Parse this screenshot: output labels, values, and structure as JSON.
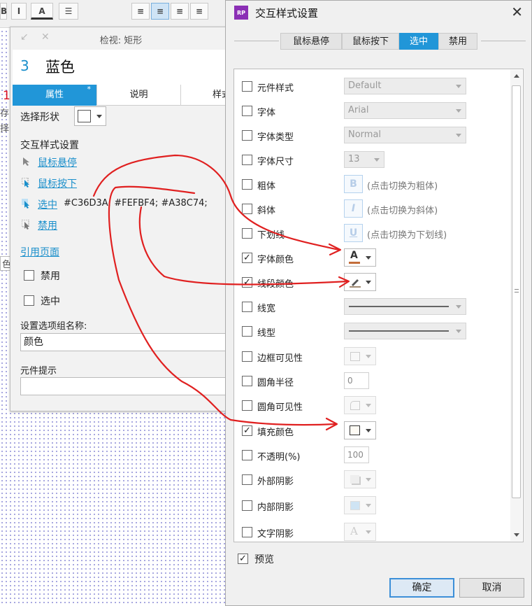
{
  "left_panel": {
    "fragments": [
      "1",
      "存",
      "择",
      "色"
    ]
  },
  "inspector": {
    "title": "检视: 矩形",
    "shape_number": "3",
    "shape_name": "蓝色",
    "tabs": [
      {
        "label": "属性",
        "active": true,
        "marker": "*"
      },
      {
        "label": "说明"
      },
      {
        "label": "样式"
      }
    ],
    "select_shape_label": "选择形状",
    "interaction_heading": "交互样式设置",
    "hover_link": "鼠标悬停",
    "mousedown_link": "鼠标按下",
    "selected_link": "选中",
    "selected_values": "#C36D3A; #FEFBF4; #A38C74;",
    "disabled_link": "禁用",
    "ref_page_link": "引用页面",
    "disabled_cb": "禁用",
    "selected_cb": "选中",
    "group_label": "设置选项组名称:",
    "group_value": "颜色",
    "tooltip_label": "元件提示"
  },
  "dialog": {
    "title": "交互样式设置",
    "logo_text": "RP",
    "tabs": [
      "鼠标悬停",
      "鼠标按下",
      "选中",
      "禁用"
    ],
    "active_tab": "选中",
    "rows": {
      "widget_style": {
        "label": "元件样式",
        "value": "Default"
      },
      "font": {
        "label": "字体",
        "value": "Arial"
      },
      "font_type": {
        "label": "字体类型",
        "value": "Normal"
      },
      "font_size": {
        "label": "字体尺寸",
        "value": "13"
      },
      "bold": {
        "label": "粗体",
        "hint": "(点击切换为粗体)",
        "icon": "B"
      },
      "italic": {
        "label": "斜体",
        "hint": "(点击切换为斜体)",
        "icon": "I"
      },
      "underline": {
        "label": "下划线",
        "hint": "(点击切换为下划线)",
        "icon": "U"
      },
      "font_color": {
        "label": "字体颜色",
        "checked": true,
        "color": "#C36D3A"
      },
      "line_color": {
        "label": "线段颜色",
        "checked": true,
        "color": "#A38C74"
      },
      "line_width": {
        "label": "线宽"
      },
      "line_type": {
        "label": "线型"
      },
      "border_vis": {
        "label": "边框可见性"
      },
      "corner_radius": {
        "label": "圆角半径",
        "value": "0"
      },
      "corner_vis": {
        "label": "圆角可见性"
      },
      "fill_color": {
        "label": "填充颜色",
        "checked": true,
        "color": "#FEFBF4"
      },
      "opacity": {
        "label": "不透明(%)",
        "value": "100"
      },
      "outer_shadow": {
        "label": "外部阴影"
      },
      "inner_shadow": {
        "label": "内部阴影"
      },
      "text_shadow": {
        "label": "文字阴影"
      }
    },
    "preview_label": "预览",
    "ok_label": "确定",
    "cancel_label": "取消"
  },
  "annotation_color": "#E02020"
}
